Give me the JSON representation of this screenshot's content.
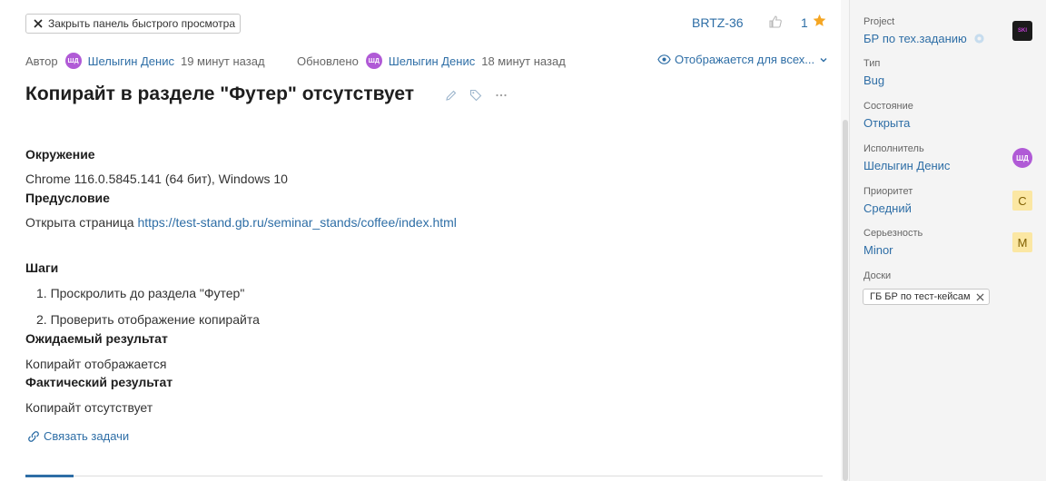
{
  "quickview": {
    "close_label": "Закрыть панель быстрого просмотра"
  },
  "header": {
    "issue_key": "BRTZ-36",
    "votes": "1"
  },
  "meta": {
    "author_label": "Автор",
    "author_initials": "ШД",
    "author_name": "Шелыгин Денис",
    "created_ago": "19 минут назад",
    "updated_label": "Обновлено",
    "updater_initials": "ШД",
    "updater_name": "Шелыгин Денис",
    "updated_ago": "18 минут назад",
    "visibility": "Отображается для всех..."
  },
  "issue": {
    "title": "Копирайт в разделе \"Футер\" отсутствует",
    "env_heading": "Окружение",
    "env_text": "Chrome 116.0.5845.141 (64 бит), Windows 10",
    "precondition_heading": "Предусловие",
    "precondition_prefix": "Открыта страница ",
    "precondition_url": "https://test-stand.gb.ru/seminar_stands/coffee/index.html",
    "steps_heading": "Шаги",
    "steps": [
      "1. Проскролить до раздела \"Футер\"",
      "2. Проверить отображение копирайта"
    ],
    "expected_heading": "Ожидаемый результат",
    "expected_text": "Копирайт отображается",
    "actual_heading": "Фактический результат",
    "actual_text": "Копирайт отсутствует",
    "link_tasks": "Связать задачи"
  },
  "fields": {
    "project_label": "Project",
    "project_value": "БР по тех.заданию",
    "project_logo_text": "SKI",
    "type_label": "Тип",
    "type_value": "Bug",
    "state_label": "Состояние",
    "state_value": "Открыта",
    "assignee_label": "Исполнитель",
    "assignee_value": "Шелыгин Денис",
    "assignee_initials": "ШД",
    "priority_label": "Приоритет",
    "priority_value": "Средний",
    "priority_badge": "С",
    "severity_label": "Серьезность",
    "severity_value": "Minor",
    "severity_badge": "M",
    "boards_label": "Доски",
    "board_tag": "ГБ БР по тест-кейсам"
  },
  "colors": {
    "accent": "#2e6ea6",
    "avatar": "#b05ad6",
    "badge": "#fbe7a3",
    "star": "#f5a623"
  }
}
